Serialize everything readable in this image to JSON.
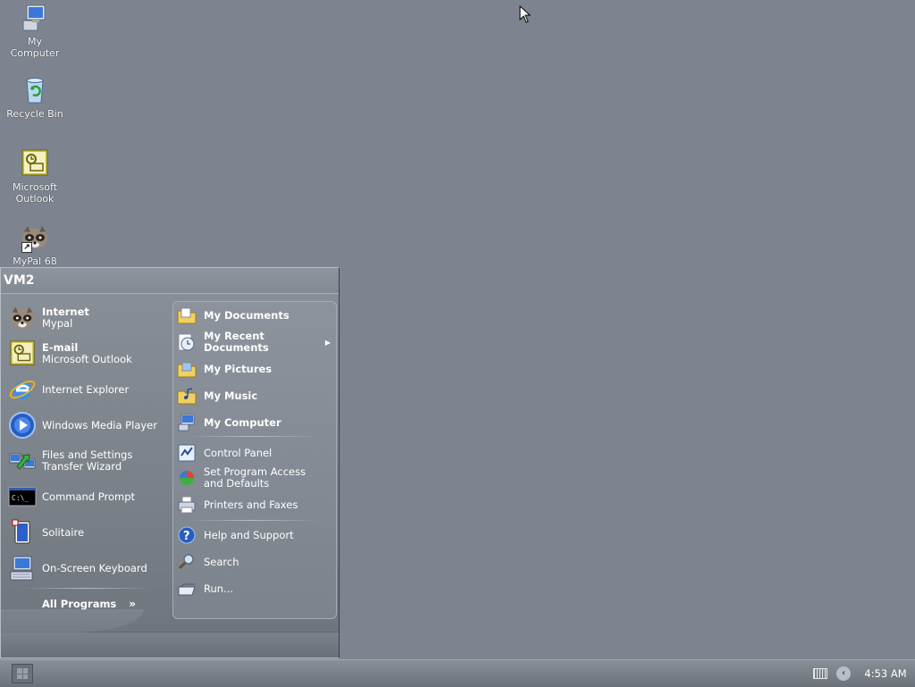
{
  "desktop": {
    "icons": [
      {
        "label": "My\nComputer",
        "icon": "my-computer-icon"
      },
      {
        "label": "Recycle Bin",
        "icon": "recycle-bin-icon"
      },
      {
        "label": "Microsoft\nOutlook",
        "icon": "outlook-icon"
      },
      {
        "label": "MyPal 68",
        "icon": "mypal-icon"
      }
    ]
  },
  "start_menu": {
    "user": "VM2",
    "pinned": [
      {
        "title": "Internet",
        "subtitle": "Mypal",
        "icon": "mypal-icon"
      },
      {
        "title": "E-mail",
        "subtitle": "Microsoft Outlook",
        "icon": "outlook-icon"
      }
    ],
    "recent": [
      {
        "label": "Internet Explorer",
        "icon": "internet-explorer-icon"
      },
      {
        "label": "Windows Media Player",
        "icon": "media-player-icon"
      },
      {
        "label": "Files and Settings\nTransfer Wizard",
        "icon": "transfer-wizard-icon"
      },
      {
        "label": "Command Prompt",
        "icon": "command-prompt-icon"
      },
      {
        "label": "Solitaire",
        "icon": "solitaire-icon"
      },
      {
        "label": "On-Screen Keyboard",
        "icon": "onscreen-keyboard-icon"
      }
    ],
    "all_programs": "All Programs",
    "places": [
      {
        "label": "My Documents",
        "icon": "folder-documents-icon"
      },
      {
        "label": "My Recent\nDocuments",
        "icon": "recent-documents-icon"
      },
      {
        "label": "My Pictures",
        "icon": "folder-pictures-icon"
      },
      {
        "label": "My Music",
        "icon": "folder-music-icon"
      },
      {
        "label": "My Computer",
        "icon": "my-computer-icon"
      }
    ],
    "system": [
      {
        "label": "Control Panel",
        "icon": "control-panel-icon"
      },
      {
        "label": "Set Program Access\nand Defaults",
        "icon": "program-defaults-icon"
      },
      {
        "label": "Printers and Faxes",
        "icon": "printer-icon"
      }
    ],
    "tools": [
      {
        "label": "Help and Support",
        "icon": "help-icon"
      },
      {
        "label": "Search",
        "icon": "search-icon"
      },
      {
        "label": "Run...",
        "icon": "run-icon"
      }
    ]
  },
  "taskbar": {
    "clock": "4:53 AM"
  },
  "colors": {
    "desktop": "#7d8490",
    "menu": "#80868e",
    "taskbar": "#7a8088"
  }
}
